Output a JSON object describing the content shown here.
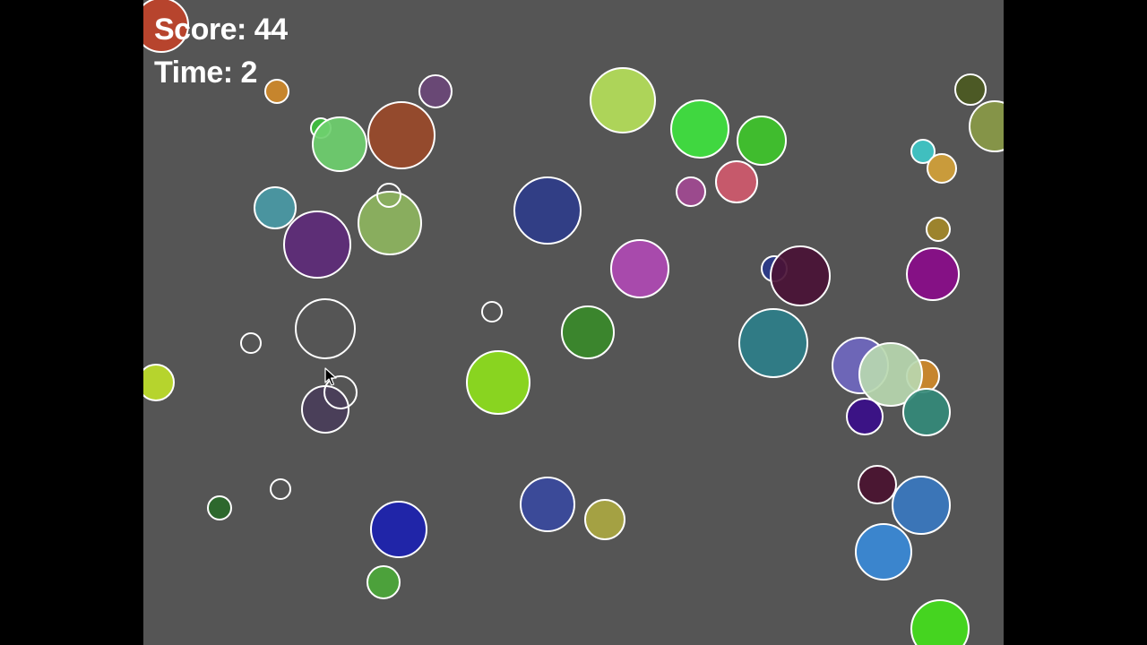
{
  "hud": {
    "score_label": "Score:",
    "score_value": "44",
    "time_label": "Time:",
    "time_value": "2"
  },
  "colors": {
    "window_background": "#000000",
    "stage_background": "#555555",
    "text": "#ffffff",
    "bubble_outline": "#ffffff"
  },
  "icons": {
    "cursor": "mouse-pointer-icon"
  },
  "bubbles": [
    {
      "color": "#c0432a"
    },
    {
      "color": "#d08a2a"
    },
    {
      "color": "#6b4878"
    },
    {
      "color": "#3ec23e"
    },
    {
      "color": "#6fd06f"
    },
    {
      "color": "#9a4a2a"
    },
    {
      "color": "#b5e05a"
    },
    {
      "color": "#3fe33f"
    },
    {
      "color": "#3fc52b"
    },
    {
      "color": "#4c5a22"
    },
    {
      "color": "#8a9a48"
    },
    {
      "color": "#3fc9c9"
    },
    {
      "color": "#d4a23a"
    },
    {
      "color": "#4a9aa6"
    },
    {
      "color": "#8eb560"
    },
    {
      "color": "none"
    },
    {
      "color": "#5e2b7a"
    },
    {
      "color": "#2f3d8a"
    },
    {
      "color": "#a24a92"
    },
    {
      "color": "#d05a6e"
    },
    {
      "color": "#a3882a"
    },
    {
      "color": "#b04ab4"
    },
    {
      "color": "#2a3a8a"
    },
    {
      "color": "#4a1236"
    },
    {
      "color": "#8a0c8a"
    },
    {
      "color": "none"
    },
    {
      "color": "none"
    },
    {
      "color": "none"
    },
    {
      "color": "#3a8a2a"
    },
    {
      "color": "#2e7f8a"
    },
    {
      "color": "#bfe02a"
    },
    {
      "color": "#8ee01c"
    },
    {
      "color": "#4a3e5a"
    },
    {
      "color": "none"
    },
    {
      "color": "#7068c0"
    },
    {
      "color": "#d08a2a"
    },
    {
      "color": "#b8d8b0"
    },
    {
      "color": "#348a7a"
    },
    {
      "color": "#3a0e8a"
    },
    {
      "color": "none"
    },
    {
      "color": "#2a6a2a"
    },
    {
      "color": "#1c22b0"
    },
    {
      "color": "#3a4a9e"
    },
    {
      "color": "#aba842"
    },
    {
      "color": "#4a1230"
    },
    {
      "color": "#3a78c0"
    },
    {
      "color": "#3a8ad8"
    },
    {
      "color": "#4ca83a"
    },
    {
      "color": "#44e01c"
    }
  ]
}
